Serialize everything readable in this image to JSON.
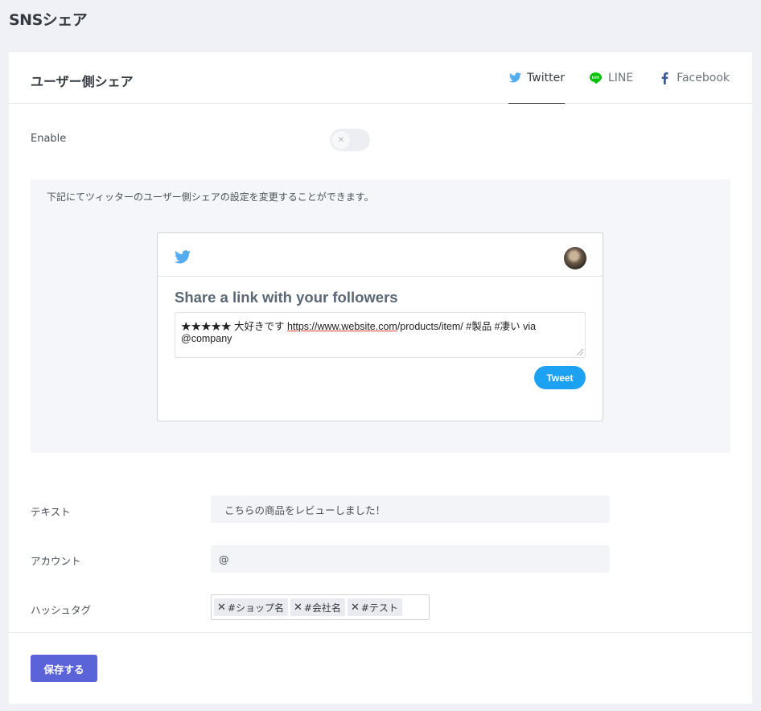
{
  "page": {
    "title": "SNSシェア"
  },
  "card": {
    "title": "ユーザー側シェア",
    "tabs": [
      {
        "label": "Twitter",
        "icon": "twitter-icon",
        "active": true
      },
      {
        "label": "LINE",
        "icon": "line-icon",
        "active": false
      },
      {
        "label": "Facebook",
        "icon": "facebook-icon",
        "active": false
      }
    ]
  },
  "enable": {
    "label": "Enable",
    "on": false
  },
  "info": {
    "text": "下記にてツィッターのユーザー側シェアの設定を変更することができます。"
  },
  "preview": {
    "heading": "Share a link with your followers",
    "text_prefix": "★★★★★ 大好きです ",
    "text_link": "https://www.website.com",
    "text_suffix": "/products/item/ #製品 #凄い via @company",
    "button": "Tweet"
  },
  "fields": {
    "text_label": "テキスト",
    "text_value": "こちらの商品をレビューしました！",
    "account_label": "アカウント",
    "account_value": "@",
    "hashtag_label": "ハッシュタグ",
    "hashtags": [
      "#ショップ名",
      "#会社名",
      "#テスト"
    ]
  },
  "save": {
    "label": "保存する"
  },
  "colors": {
    "twitter": "#55acee",
    "line": "#00c300",
    "facebook": "#3b5998",
    "tweet_button": "#1da1f2",
    "save_button": "#5b63d9"
  }
}
